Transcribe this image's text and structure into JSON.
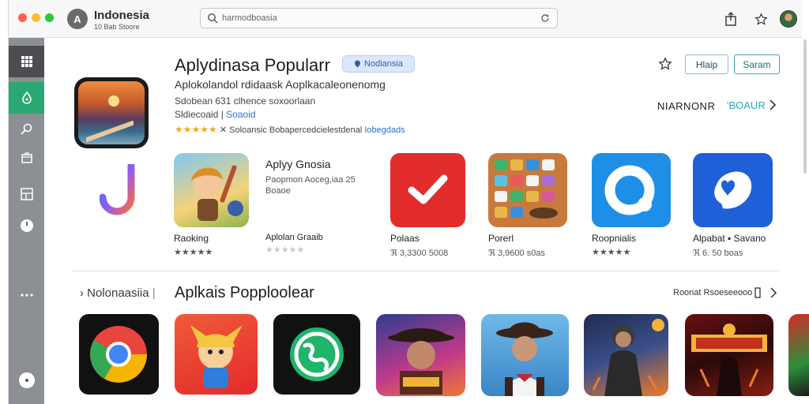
{
  "window": {
    "app_title": "Indonesia",
    "app_subtitle": "10 Bab Stoore",
    "app_icon_letter": "A",
    "search_value": "harmodboasia"
  },
  "hero": {
    "title": "Aplydinasa Popularr",
    "badge": "Nodiansia",
    "description": "Aplokolandol rdidaask Aoplkacaleonenomg",
    "meta1": "Sdobean 631 clhence soxoorlaan",
    "meta2_prefix": "Sldiecoaid |",
    "meta2_link": "Soaoid",
    "stars": "★★★★★",
    "rating_text": "✕ Soloansic Bobapercedcielestdenal",
    "rating_link": "Iobegdads",
    "btn_primary": "Hlaip",
    "btn_secondary": "Saram",
    "more_label": "NIARNONR",
    "more_link": "'BOAUR"
  },
  "featured_cards": [
    {
      "name": "Raoking",
      "rating": "★★★★★",
      "icon": "adventure-boy-icon"
    },
    {
      "name": "Aplolan Graaib",
      "rating": "★★★★★",
      "icon": "app-tile-icon",
      "promo_title": "Aplyy Gnosia",
      "promo_line1": "Paopmon Aoceg,iaa 25",
      "promo_line2": "Boaoe"
    },
    {
      "name": "Polaas",
      "rating": "ℜ 3,3300 5008",
      "icon": "checkmark-icon"
    },
    {
      "name": "Porerl",
      "rating": "ℜ 3,9600 s0as",
      "icon": "apps-grid-icon"
    },
    {
      "name": "Roopnialis",
      "rating": "★★★★★",
      "icon": "chat-bubble-icon"
    },
    {
      "name": "Alpabat ▪ Savano",
      "rating": "ℜ 6. 50 boas",
      "icon": "heart-shield-icon"
    }
  ],
  "section": {
    "left_label": "Nolonaasiia",
    "title": "Aplkais Popploolear",
    "right_label": "Roonat Rsoeseeooo"
  },
  "bottom_apps": [
    {
      "icon": "chrome-icon"
    },
    {
      "icon": "cartoon-hero-icon"
    },
    {
      "icon": "globe-icon"
    },
    {
      "icon": "cowboy-game-icon"
    },
    {
      "icon": "cowboy-portrait-icon"
    },
    {
      "icon": "soldier-game-icon"
    },
    {
      "icon": "fantasy-game-icon"
    },
    {
      "icon": "partial-game-icon"
    }
  ],
  "colors": {
    "sidebar": "#8c8f93",
    "sidebar_active": "#2aa873",
    "accent_blue": "#2d6fd6",
    "star": "#f2a81d"
  }
}
